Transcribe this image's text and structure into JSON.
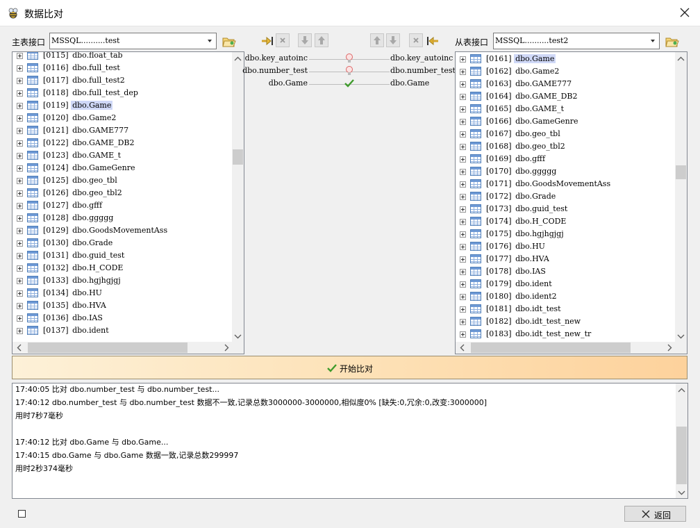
{
  "window": {
    "title": "数据比对",
    "close_icon": "close-icon",
    "app_icon": "bee-icon"
  },
  "master": {
    "label": "主表接口",
    "connection": "MSSQL..........test",
    "items": [
      {
        "idx": "[0115]",
        "name": "dbo.float_tab"
      },
      {
        "idx": "[0116]",
        "name": "dbo.full_test"
      },
      {
        "idx": "[0117]",
        "name": "dbo.full_test2"
      },
      {
        "idx": "[0118]",
        "name": "dbo.full_test_dep"
      },
      {
        "idx": "[0119]",
        "name": "dbo.Game",
        "selected": true
      },
      {
        "idx": "[0120]",
        "name": "dbo.Game2"
      },
      {
        "idx": "[0121]",
        "name": "dbo.GAME777"
      },
      {
        "idx": "[0122]",
        "name": "dbo.GAME_DB2"
      },
      {
        "idx": "[0123]",
        "name": "dbo.GAME_t"
      },
      {
        "idx": "[0124]",
        "name": "dbo.GameGenre"
      },
      {
        "idx": "[0125]",
        "name": "dbo.geo_tbl"
      },
      {
        "idx": "[0126]",
        "name": "dbo.geo_tbl2"
      },
      {
        "idx": "[0127]",
        "name": "dbo.gfff"
      },
      {
        "idx": "[0128]",
        "name": "dbo.ggggg"
      },
      {
        "idx": "[0129]",
        "name": "dbo.GoodsMovementAss"
      },
      {
        "idx": "[0130]",
        "name": "dbo.Grade"
      },
      {
        "idx": "[0131]",
        "name": "dbo.guid_test"
      },
      {
        "idx": "[0132]",
        "name": "dbo.H_CODE"
      },
      {
        "idx": "[0133]",
        "name": "dbo.hgjhgjgj"
      },
      {
        "idx": "[0134]",
        "name": "dbo.HU"
      },
      {
        "idx": "[0135]",
        "name": "dbo.HVA"
      },
      {
        "idx": "[0136]",
        "name": "dbo.IAS"
      },
      {
        "idx": "[0137]",
        "name": "dbo.ident"
      }
    ]
  },
  "slave": {
    "label": "从表接口",
    "connection": "MSSQL..........test2",
    "items": [
      {
        "idx": "[0161]",
        "name": "dbo.Game",
        "selected": true
      },
      {
        "idx": "[0162]",
        "name": "dbo.Game2"
      },
      {
        "idx": "[0163]",
        "name": "dbo.GAME777"
      },
      {
        "idx": "[0164]",
        "name": "dbo.GAME_DB2"
      },
      {
        "idx": "[0165]",
        "name": "dbo.GAME_t"
      },
      {
        "idx": "[0166]",
        "name": "dbo.GameGenre"
      },
      {
        "idx": "[0167]",
        "name": "dbo.geo_tbl"
      },
      {
        "idx": "[0168]",
        "name": "dbo.geo_tbl2"
      },
      {
        "idx": "[0169]",
        "name": "dbo.gfff"
      },
      {
        "idx": "[0170]",
        "name": "dbo.ggggg"
      },
      {
        "idx": "[0171]",
        "name": "dbo.GoodsMovementAss"
      },
      {
        "idx": "[0172]",
        "name": "dbo.Grade"
      },
      {
        "idx": "[0173]",
        "name": "dbo.guid_test"
      },
      {
        "idx": "[0174]",
        "name": "dbo.H_CODE"
      },
      {
        "idx": "[0175]",
        "name": "dbo.hgjhgjgj"
      },
      {
        "idx": "[0176]",
        "name": "dbo.HU"
      },
      {
        "idx": "[0177]",
        "name": "dbo.HVA"
      },
      {
        "idx": "[0178]",
        "name": "dbo.IAS"
      },
      {
        "idx": "[0179]",
        "name": "dbo.ident"
      },
      {
        "idx": "[0180]",
        "name": "dbo.ident2"
      },
      {
        "idx": "[0181]",
        "name": "dbo.idt_test"
      },
      {
        "idx": "[0182]",
        "name": "dbo.idt_test_new"
      },
      {
        "idx": "[0183]",
        "name": "dbo.idt_test_new_tr"
      }
    ]
  },
  "mappings": [
    {
      "left": "dbo.key_autoinc",
      "right": "dbo.key_autoinc",
      "status": "warning",
      "icon": "lightbulb-icon"
    },
    {
      "left": "dbo.number_test",
      "right": "dbo.number_test",
      "status": "warning",
      "icon": "lightbulb-icon"
    },
    {
      "left": "dbo.Game",
      "right": "dbo.Game",
      "status": "ok",
      "icon": "check-icon"
    }
  ],
  "start_button": {
    "label": "开始比对",
    "icon": "check-icon"
  },
  "log": [
    "17:40:05 比对 dbo.number_test 与 dbo.number_test...",
    "17:40:12 dbo.number_test 与 dbo.number_test 数据不一致,记录总数3000000-3000000,相似度0% [缺失:0,冗余:0,改变:3000000]",
    "用时7秒7毫秒",
    "",
    "17:40:12 比对 dbo.Game 与 dbo.Game...",
    "17:40:15 dbo.Game 与 dbo.Game 数据一致,记录总数299997",
    "用时2秒374毫秒"
  ],
  "back_button": {
    "label": "返回"
  },
  "colors": {
    "selection": "#cfd8f7",
    "start_gradient_start": "#fdf1d8",
    "start_gradient_end": "#fdd29c"
  }
}
